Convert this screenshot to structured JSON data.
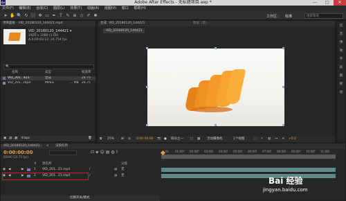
{
  "window": {
    "title": "Adobe After Effects - 无标题项目.aep *",
    "app_icon_text": "Ae",
    "minimize": "—",
    "maximize": "□",
    "close": "✕"
  },
  "menu": [
    "文件(F)",
    "编辑(E)",
    "合成(C)",
    "图层(L)",
    "效果(T)",
    "动画(A)",
    "视图(V)",
    "窗口",
    "帮助(H)"
  ],
  "toolbar": {
    "workspace_label": "工作区：",
    "workspace_value": "标准",
    "search_placeholder": "搜索帮助"
  },
  "project": {
    "tab_label": "项目面板 - VID_20180120_144421.mp4",
    "item_name": "VID_20180120_144421 ▾",
    "item_size": "1920 x 1080 (1.00)",
    "item_duration": "Δ 0:00:03:12, 24.754 fps",
    "search_icon": "🔍",
    "columns": [
      "名称",
      "类型",
      "帧速率"
    ],
    "rows": [
      {
        "name": "VID_201...421",
        "type": "合成",
        "fps": "24.75",
        "selected": true
      },
      {
        "name": "VID_201...mp4",
        "type": "MPEG",
        "size": "... MB",
        "fps": "24.75",
        "selected": false
      }
    ],
    "bpc": "8 bpc"
  },
  "composition": {
    "tab_label": "合成: VID_20180120_144421",
    "layer_tab": "图层: (无)",
    "breadcrumb": "VID_20180120_144421",
    "bottom": {
      "zoom": "25%",
      "timecode": "0:00:00:00",
      "quality": "四分之一",
      "camera": "活动摄像机",
      "views": "1个视图",
      "exposure": "+0.0"
    }
  },
  "right_panel": {
    "tab_label": "信息",
    "items": [
      "信",
      "音",
      "预",
      "效",
      "字",
      "段",
      "跟",
      "摇",
      "动"
    ]
  },
  "timeline": {
    "tab_label": "VID_20180120_144421",
    "render_tab": "渲染队列",
    "current_time": "0:00:00:00",
    "fps_note": "00000 (24.75 fps)",
    "columns": [
      "#",
      "源名称",
      "父级"
    ],
    "ruler_ticks": [
      "0s",
      "01:00f",
      "02:00f",
      "03:00f",
      "04:00f",
      "05:00f",
      "06:00f",
      "07:00f",
      "08:00f",
      "09:00f",
      "10:00f",
      "11:00f"
    ],
    "layers": [
      {
        "num": "1",
        "name": "VID_201...21.mp4",
        "parent": "无"
      },
      {
        "num": "2",
        "name": "VID_201...21.mp4",
        "parent": "无"
      }
    ],
    "bottom_label": "切换开关/模式"
  },
  "watermark": {
    "line1": "Bai 经验",
    "line2": "jingyan.baidu.com"
  }
}
